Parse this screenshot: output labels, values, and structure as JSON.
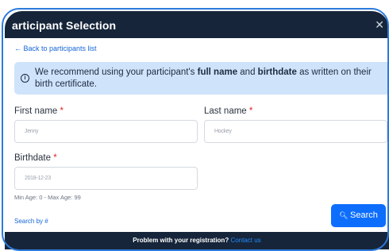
{
  "dialog": {
    "title": "articipant Selection",
    "close_glyph": "✕"
  },
  "nav": {
    "back_link": "← Back to participants list"
  },
  "notice": {
    "icon": "info-icon",
    "text_before": "We recommend using your participant's ",
    "bold1": "full name",
    "text_mid": " and ",
    "bold2": "birthdate",
    "text_after": " as written on their birth certificate."
  },
  "form": {
    "first_name_label": "First name",
    "last_name_label": "Last name",
    "birthdate_label": "Birthdate",
    "required_mark": "*",
    "first_name_value": "Jenny",
    "last_name_value": "Hockey",
    "birthdate_value": "2018-12-23",
    "age_hint": "Min Age: 0 - Max Age: 99"
  },
  "actions": {
    "search_by": "Search by #",
    "search_button": "Search",
    "search_icon": "magnifier-icon"
  },
  "footer": {
    "text": "Problem with your registration?",
    "link": "Contact us"
  },
  "colors": {
    "header_bg": "#16253a",
    "notice_bg": "#cfe3fb",
    "accent": "#0d6efd",
    "link": "#1565d8",
    "required": "#e02424"
  }
}
